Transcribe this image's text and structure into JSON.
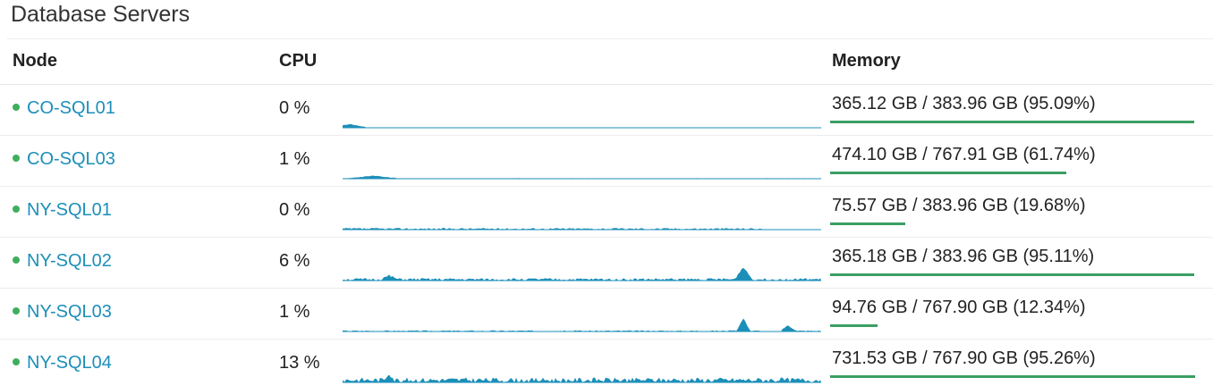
{
  "panel": {
    "title": "Database Servers"
  },
  "columns": {
    "node": "Node",
    "cpu": "CPU",
    "memory": "Memory"
  },
  "colors": {
    "link": "#1c8fb8",
    "status_ok": "#3fae5e",
    "sparkline": "#1c8fb8",
    "memory_bar": "#3b9e63"
  },
  "servers": [
    {
      "name": "CO-SQL01",
      "status": "ok",
      "cpu": "0 %",
      "memory": "365.12 GB / 383.96 GB (95.09%)",
      "memory_pct": 95.09
    },
    {
      "name": "CO-SQL03",
      "status": "ok",
      "cpu": "1 %",
      "memory": "474.10 GB / 767.91 GB (61.74%)",
      "memory_pct": 61.74
    },
    {
      "name": "NY-SQL01",
      "status": "ok",
      "cpu": "0 %",
      "memory": "75.57 GB / 383.96 GB (19.68%)",
      "memory_pct": 19.68
    },
    {
      "name": "NY-SQL02",
      "status": "ok",
      "cpu": "6 %",
      "memory": "365.18 GB / 383.96 GB (95.11%)",
      "memory_pct": 95.11
    },
    {
      "name": "NY-SQL03",
      "status": "ok",
      "cpu": "1 %",
      "memory": "94.76 GB / 767.90 GB (12.34%)",
      "memory_pct": 12.34
    },
    {
      "name": "NY-SQL04",
      "status": "ok",
      "cpu": "13 %",
      "memory": "731.53 GB / 767.90 GB (95.26%)",
      "memory_pct": 95.26
    }
  ]
}
